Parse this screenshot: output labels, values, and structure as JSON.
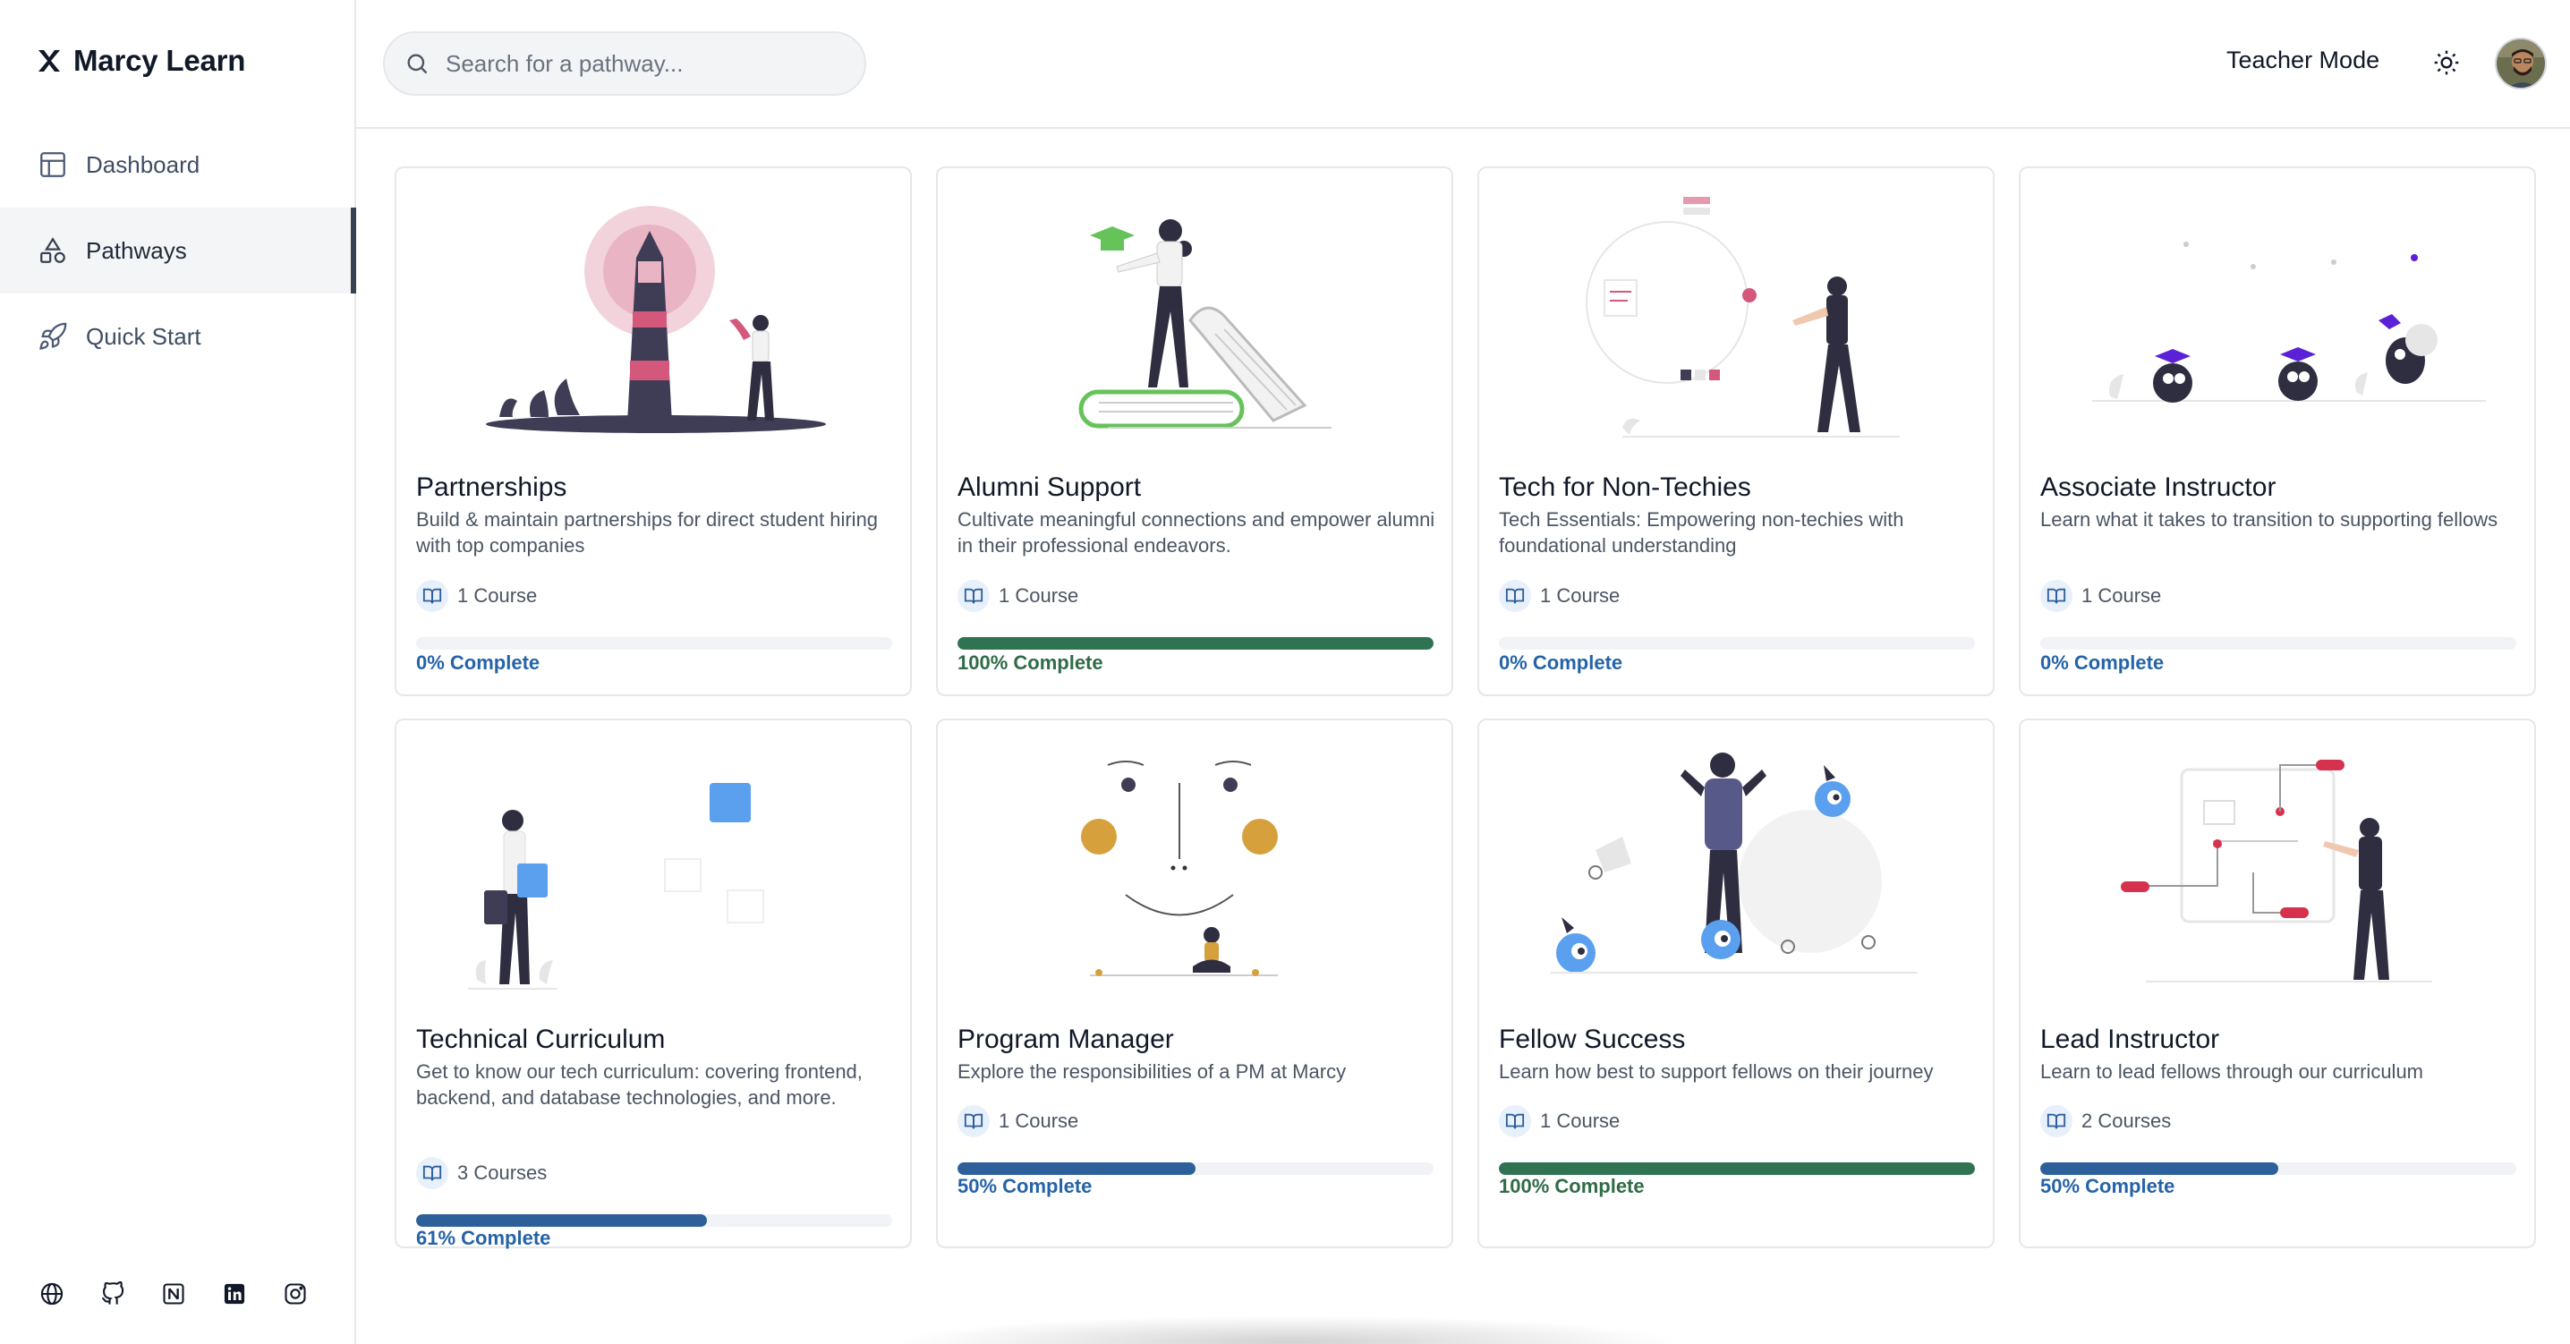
{
  "brand": {
    "name": "Marcy Learn",
    "logo_icon": "x-logo-icon"
  },
  "sidebar": {
    "items": [
      {
        "label": "Dashboard",
        "icon": "layout-icon",
        "active": false
      },
      {
        "label": "Pathways",
        "icon": "shapes-icon",
        "active": true
      },
      {
        "label": "Quick Start",
        "icon": "rocket-icon",
        "active": false
      }
    ],
    "social": [
      "globe-icon",
      "github-icon",
      "notion-icon",
      "linkedin-icon",
      "instagram-icon"
    ]
  },
  "header": {
    "search_placeholder": "Search for a pathway...",
    "teacher_mode_label": "Teacher Mode",
    "theme_icon": "sun-icon"
  },
  "colors": {
    "blue_text": "#2563a8",
    "blue_fill": "#2d5f9a",
    "green_text": "#2f6b47",
    "green_fill": "#2f7352"
  },
  "pathways": [
    {
      "title": "Partnerships",
      "description": "Build & maintain partnerships for direct student hiring with top companies",
      "courses": "1 Course",
      "progress_label": "0% Complete",
      "progress": 0,
      "status": "blue"
    },
    {
      "title": "Alumni Support",
      "description": "Cultivate meaningful connections and empower alumni in their professional endeavors.",
      "courses": "1 Course",
      "progress_label": "100% Complete",
      "progress": 100,
      "status": "green"
    },
    {
      "title": "Tech for Non-Techies",
      "description": "Tech Essentials: Empowering non-techies with foundational understanding",
      "courses": "1 Course",
      "progress_label": "0% Complete",
      "progress": 0,
      "status": "blue"
    },
    {
      "title": "Associate Instructor",
      "description": "Learn what it takes to transition to supporting fellows",
      "courses": "1 Course",
      "progress_label": "0% Complete",
      "progress": 0,
      "status": "blue"
    },
    {
      "title": "Technical Curriculum",
      "description": "Get to know our tech curriculum: covering frontend, backend, and database technologies, and more.",
      "courses": "3 Courses",
      "progress_label": "61% Complete",
      "progress": 61,
      "status": "blue"
    },
    {
      "title": "Program Manager",
      "description": "Explore the responsibilities of a PM at Marcy",
      "courses": "1 Course",
      "progress_label": "50% Complete",
      "progress": 50,
      "status": "blue"
    },
    {
      "title": "Fellow Success",
      "description": "Learn how best to support fellows on their journey",
      "courses": "1 Course",
      "progress_label": "100% Complete",
      "progress": 100,
      "status": "green"
    },
    {
      "title": "Lead Instructor",
      "description": "Learn to lead fellows through our curriculum",
      "courses": "2 Courses",
      "progress_label": "50% Complete",
      "progress": 50,
      "status": "blue"
    }
  ]
}
